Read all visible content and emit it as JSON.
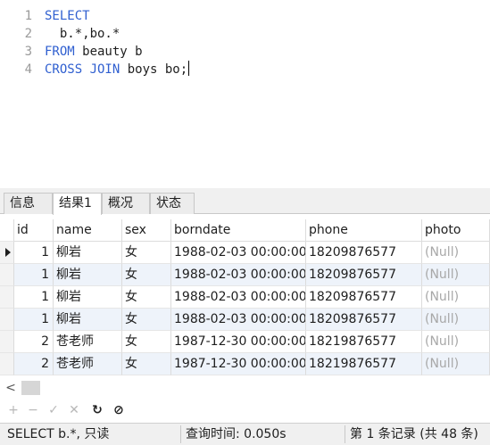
{
  "editor": {
    "lines": [
      {
        "number": "1",
        "keyword": "SELECT",
        "text": ""
      },
      {
        "number": "2",
        "keyword": "",
        "text": "  b.*,bo.*"
      },
      {
        "number": "3",
        "keyword": "FROM",
        "text": " beauty b"
      },
      {
        "number": "4",
        "keyword": "CROSS JOIN",
        "text": " boys bo;"
      }
    ]
  },
  "tabs": [
    {
      "label": "信息",
      "active": false
    },
    {
      "label": "结果1",
      "active": true
    },
    {
      "label": "概况",
      "active": false
    },
    {
      "label": "状态",
      "active": false
    }
  ],
  "grid": {
    "columns": [
      "id",
      "name",
      "sex",
      "borndate",
      "phone",
      "photo"
    ],
    "rows": [
      [
        "1",
        "柳岩",
        "女",
        "1988-02-03 00:00:00",
        "18209876577",
        "(Null)"
      ],
      [
        "1",
        "柳岩",
        "女",
        "1988-02-03 00:00:00",
        "18209876577",
        "(Null)"
      ],
      [
        "1",
        "柳岩",
        "女",
        "1988-02-03 00:00:00",
        "18209876577",
        "(Null)"
      ],
      [
        "1",
        "柳岩",
        "女",
        "1988-02-03 00:00:00",
        "18209876577",
        "(Null)"
      ],
      [
        "2",
        "苍老师",
        "女",
        "1987-12-30 00:00:00",
        "18219876577",
        "(Null)"
      ],
      [
        "2",
        "苍老师",
        "女",
        "1987-12-30 00:00:00",
        "18219876577",
        "(Null)"
      ]
    ]
  },
  "toolbar": {
    "buttons": [
      {
        "name": "add-record-button",
        "glyph": "+",
        "enabled": false
      },
      {
        "name": "delete-record-button",
        "glyph": "−",
        "enabled": false
      },
      {
        "name": "apply-changes-button",
        "glyph": "✓",
        "enabled": false
      },
      {
        "name": "discard-changes-button",
        "glyph": "✕",
        "enabled": false
      },
      {
        "name": "refresh-button",
        "glyph": "↻",
        "enabled": true
      },
      {
        "name": "stop-button",
        "glyph": "⊘",
        "enabled": true
      }
    ]
  },
  "status": {
    "sql": "SELECT   b.*, 只读",
    "query_time": "查询时间: 0.050s",
    "record": "第 1 条记录 (共 48 条)"
  }
}
